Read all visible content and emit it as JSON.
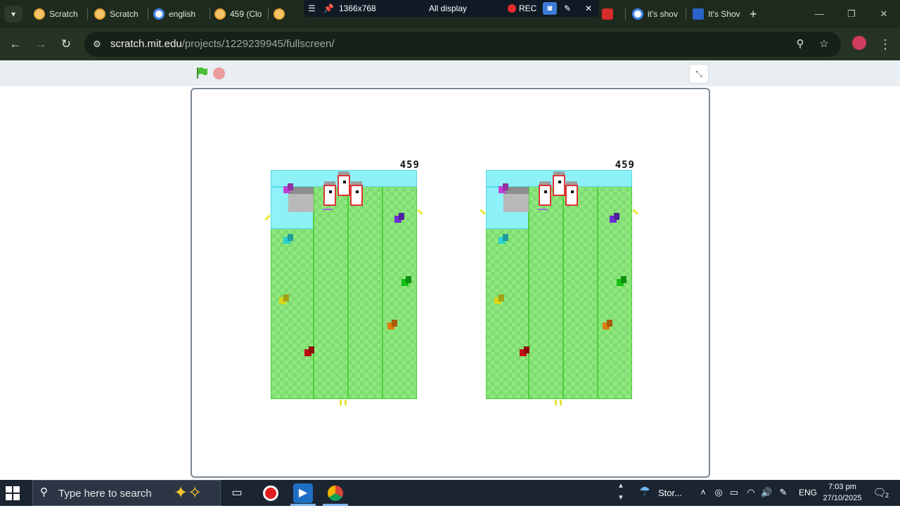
{
  "browser": {
    "tabs": [
      {
        "title": "Scratch",
        "favicon": "scratch-icon"
      },
      {
        "title": "Scratch",
        "favicon": "scratch-icon"
      },
      {
        "title": "english",
        "favicon": "google-icon"
      },
      {
        "title": "459 (Clo",
        "favicon": "scratch-icon"
      },
      {
        "title": "",
        "favicon": "scratch-icon"
      },
      {
        "title": "it's shov",
        "favicon": "google-icon"
      },
      {
        "title": "It's Shov",
        "favicon": "lp-icon"
      }
    ],
    "url_host": "scratch.mit.edu",
    "url_path": "/projects/1229239945/fullscreen/"
  },
  "recorder": {
    "resolution": "1366x768",
    "display": "All display",
    "rec_label": "REC"
  },
  "stage": {
    "scores": [
      "459",
      "459"
    ]
  },
  "taskbar": {
    "search_placeholder": "Type here to search",
    "weather": "Stor...",
    "language": "ENG",
    "time": "7:03 pm",
    "date": "27/10/2025",
    "notification_count": "2"
  },
  "colors": {
    "browser_bg": "#1f2a1e",
    "stage_green": "#8ee87f",
    "stage_cyan": "#8ef1f8",
    "eye_border": "#dd3333"
  }
}
